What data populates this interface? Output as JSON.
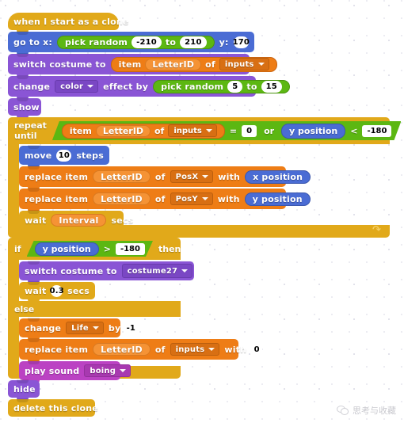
{
  "script": {
    "hat": {
      "label": "when I start as a clone"
    },
    "goto": {
      "label_x": "go to x:",
      "label_y": "y:",
      "pick_label": "pick random",
      "pick_to": "to",
      "pick_from_value": "-210",
      "pick_to_value": "210",
      "y_value": "170"
    },
    "switch_costume_top": {
      "label": "switch costume to",
      "item_label": "item",
      "index": "LetterID",
      "of_label": "of",
      "list": "inputs"
    },
    "change_effect": {
      "label_a": "change",
      "effect": "color",
      "label_b": "effect by",
      "pick_label": "pick random",
      "pick_to": "to",
      "pick_from_value": "5",
      "pick_to_value": "15"
    },
    "show": {
      "label": "show"
    },
    "repeat_until": {
      "label": "repeat until",
      "cond_item_label": "item",
      "cond_index": "LetterID",
      "cond_of": "of",
      "cond_list": "inputs",
      "eq_op": "=",
      "eq_value": "0",
      "or_op": "or",
      "y_position": "y position",
      "lt_op": "<",
      "lt_value": "-180",
      "body": {
        "move": {
          "label_a": "move",
          "steps": "10",
          "label_b": "steps"
        },
        "replace_x": {
          "label_a": "replace item",
          "index": "LetterID",
          "label_b": "of",
          "list": "PosX",
          "label_c": "with",
          "value": "x position"
        },
        "replace_y": {
          "label_a": "replace item",
          "index": "LetterID",
          "label_b": "of",
          "list": "PosY",
          "label_c": "with",
          "value": "y position"
        },
        "wait": {
          "label_a": "wait",
          "value": "Interval",
          "label_b": "secs"
        }
      }
    },
    "if_else": {
      "if_label": "if",
      "then_label": "then",
      "else_label": "else",
      "cond_reporter": "y position",
      "cond_op": ">",
      "cond_value": "-180",
      "then_branch": {
        "switch_costume": {
          "label": "switch costume to",
          "costume": "costume27"
        },
        "wait": {
          "label_a": "wait",
          "value": "0.3",
          "label_b": "secs"
        }
      },
      "else_branch": {
        "change_var": {
          "label_a": "change",
          "variable": "Life",
          "label_b": "by",
          "value": "-1"
        },
        "replace": {
          "label_a": "replace item",
          "index": "LetterID",
          "label_b": "of",
          "list": "inputs",
          "label_c": "with",
          "value": "0"
        },
        "play_sound": {
          "label": "play sound",
          "sound": "boing"
        }
      }
    },
    "hide": {
      "label": "hide"
    },
    "delete_clone": {
      "label": "delete this clone"
    }
  },
  "watermark": {
    "text": "思考与收藏",
    "icon": "wechat-icon"
  },
  "colors": {
    "control": "#e1a91a",
    "motion": "#4a6cd4",
    "looks": "#8a55d5",
    "sound": "#bb42c3",
    "data": "#ee7d16",
    "operator": "#5cb712"
  }
}
